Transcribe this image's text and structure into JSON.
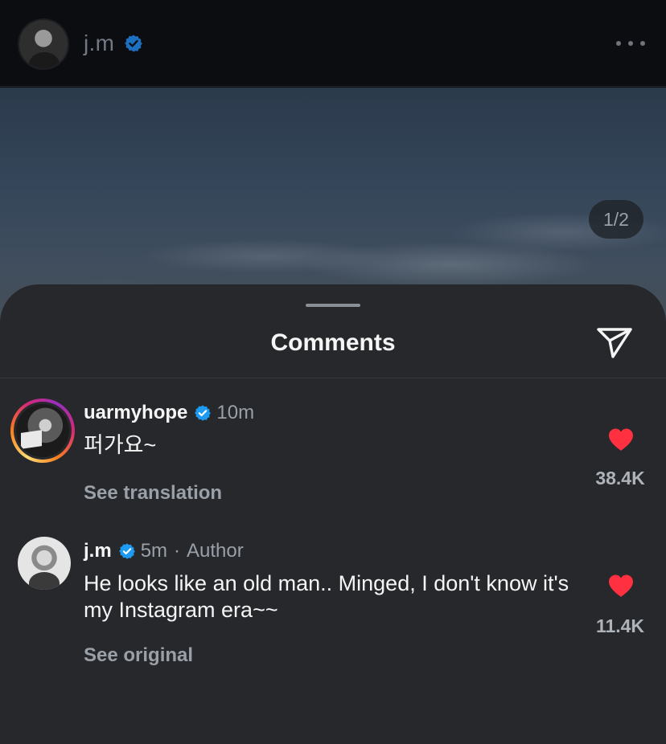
{
  "post": {
    "username": "j.m",
    "verified": true,
    "more_icon": "more-horizontal-icon",
    "page_counter": "1/2"
  },
  "comments_sheet": {
    "title": "Comments",
    "share_icon": "send-icon",
    "comments": [
      {
        "username": "uarmyhope",
        "verified": true,
        "time": "10m",
        "role": "",
        "text": "퍼가요~",
        "link": "See translation",
        "likes": "38.4K",
        "liked": true
      },
      {
        "username": "j.m",
        "verified": true,
        "time": "5m",
        "separator": "·",
        "role": "Author",
        "text": "He looks like an old man.. Minged, I don't know it's my Instagram era~~",
        "link": "See original",
        "likes": "11.4K",
        "liked": true
      }
    ]
  },
  "colors": {
    "verified": "#1d9bf0",
    "heart": "#ff3040",
    "sheet_bg": "#26282c"
  }
}
